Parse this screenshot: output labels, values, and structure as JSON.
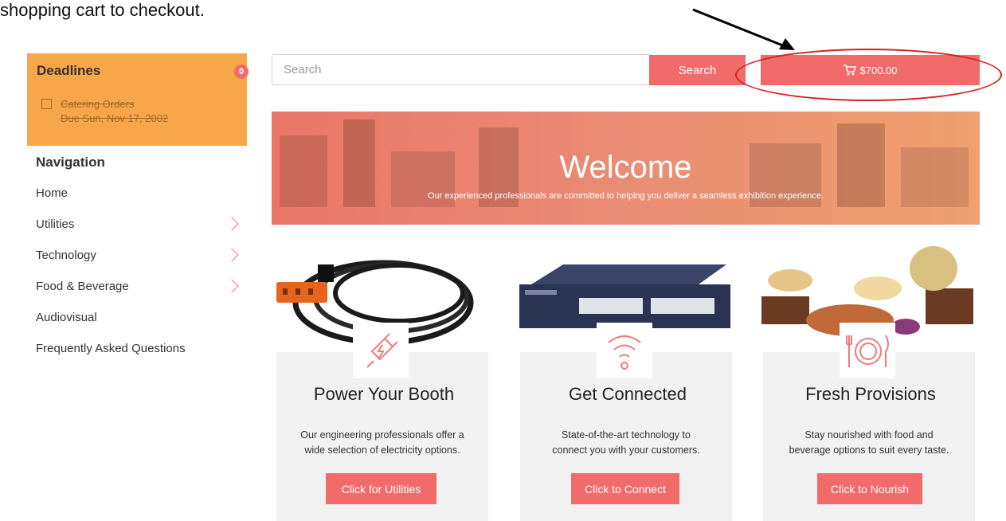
{
  "caption": "shopping cart to checkout.",
  "deadlines": {
    "title": "Deadlines",
    "badge": "0",
    "item_name": "Catering Orders",
    "item_date": "Due Sun, Nov 17, 2002"
  },
  "nav": {
    "title": "Navigation",
    "items": [
      {
        "label": "Home",
        "has_submenu": false
      },
      {
        "label": "Utilities",
        "has_submenu": true
      },
      {
        "label": "Technology",
        "has_submenu": true
      },
      {
        "label": "Food & Beverage",
        "has_submenu": true
      },
      {
        "label": "Audiovisual",
        "has_submenu": false
      },
      {
        "label": "Frequently Asked Questions",
        "has_submenu": false
      }
    ]
  },
  "search": {
    "placeholder": "Search",
    "button_label": "Search"
  },
  "cart": {
    "total": "$700.00",
    "icon": "cart-icon"
  },
  "banner": {
    "title": "Welcome",
    "subtitle": "Our experienced professionals are committed to helping you deliver a seamless exhibition experience."
  },
  "cards": [
    {
      "title": "Power Your Booth",
      "desc_line1": "Our engineering professionals offer a",
      "desc_line2": "wide selection of electricity options.",
      "button": "Click for Utilities",
      "icon": "power-plug-icon"
    },
    {
      "title": "Get Connected",
      "desc_line1": "State-of-the-art technology to",
      "desc_line2": "connect you with your customers.",
      "button": "Click to Connect",
      "icon": "wifi-icon"
    },
    {
      "title": "Fresh Provisions",
      "desc_line1": "Stay nourished with food and",
      "desc_line2": "beverage options to suit every taste.",
      "button": "Click to Nourish",
      "icon": "plate-fork-knife-icon"
    }
  ],
  "colors": {
    "accent": "#f26b6b",
    "deadlines_bg": "#f8a64a",
    "annotation": "#d92020"
  }
}
